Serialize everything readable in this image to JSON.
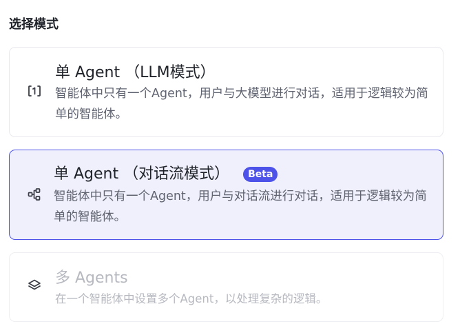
{
  "section": {
    "title": "选择模式"
  },
  "modes": [
    {
      "title": "单 Agent （LLM模式）",
      "description": "智能体中只有一个Agent，用户与大模型进行对话，适用于逻辑较为简单的智能体。",
      "icon": "single-agent-llm-icon",
      "state": "normal"
    },
    {
      "title": "单 Agent （对话流模式）",
      "badge": "Beta",
      "description": "智能体中只有一个Agent，用户与对话流进行对话，适用于逻辑较为简单的智能体。",
      "icon": "workflow-nodes-icon",
      "state": "selected"
    },
    {
      "title": "多 Agents",
      "description": "在一个智能体中设置多个Agent，以处理复杂的逻辑。",
      "icon": "layers-icon",
      "state": "disabled"
    }
  ],
  "colors": {
    "accent": "#4d53e8",
    "selected_bg": "#f0f0fc",
    "border": "#e8e9ee",
    "text_primary": "#1f2329",
    "text_secondary": "#5f6370",
    "text_disabled": "#b7b9c0"
  }
}
